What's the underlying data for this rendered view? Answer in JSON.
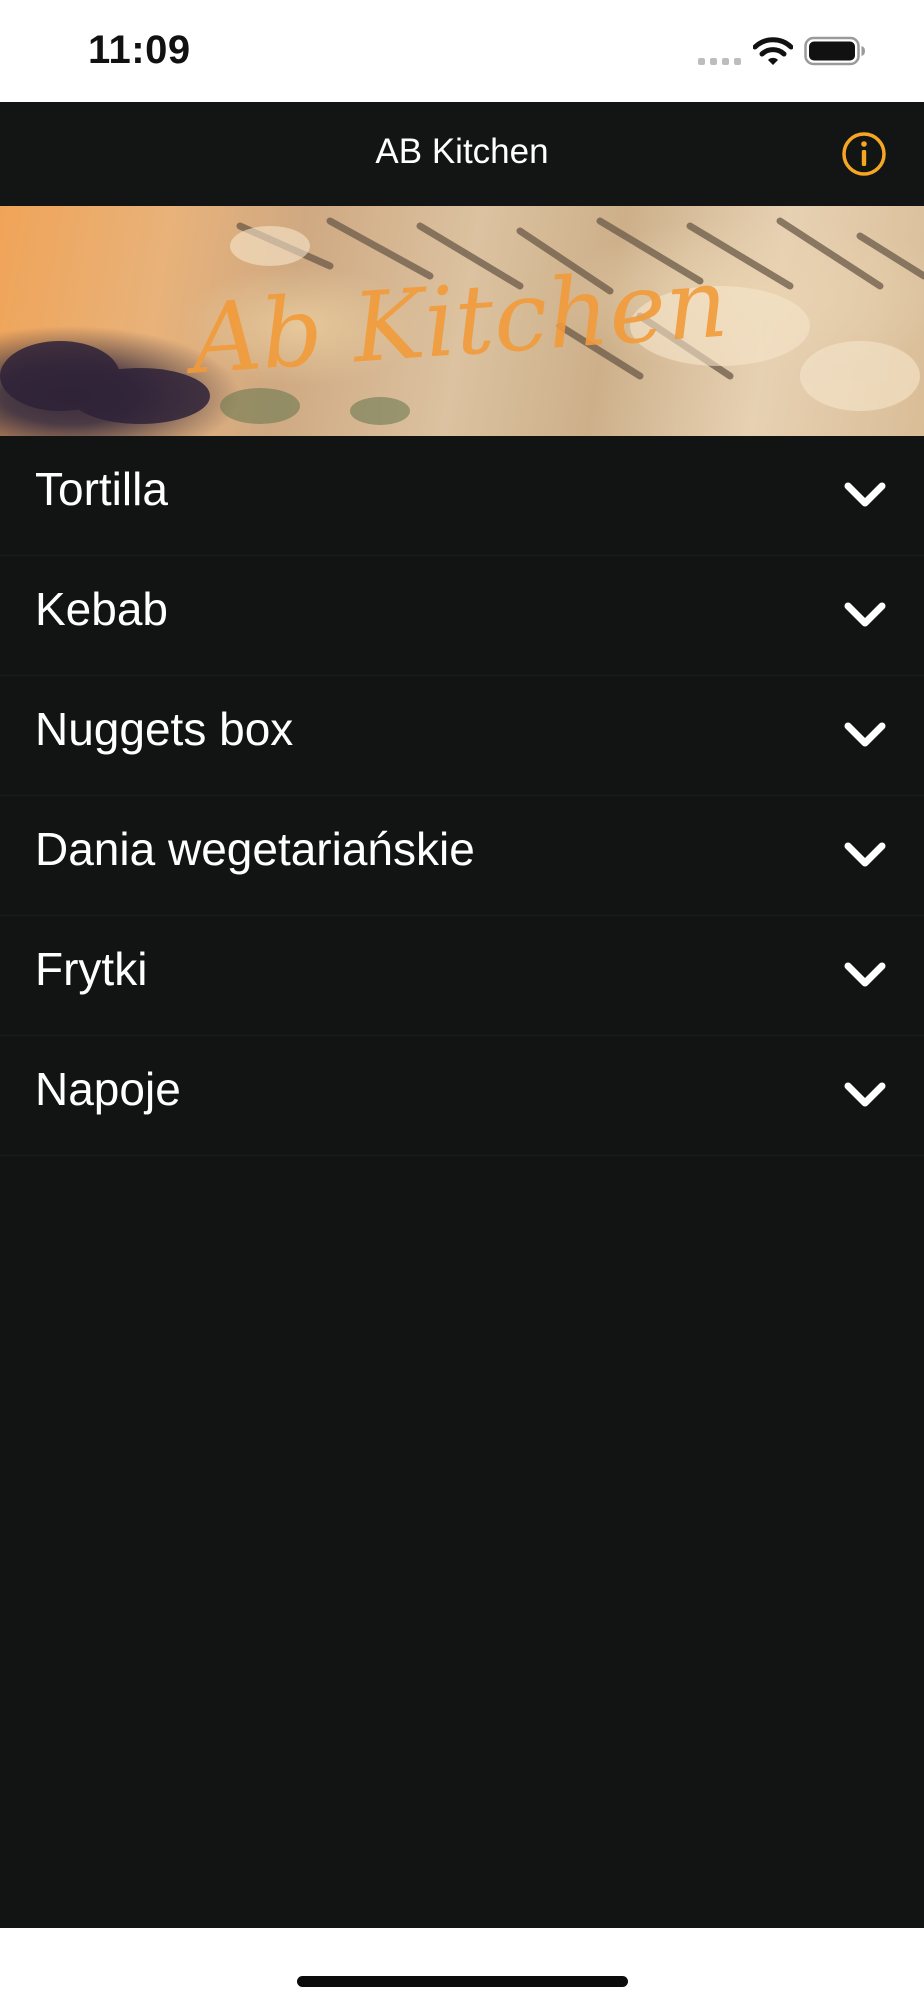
{
  "status_bar": {
    "time": "11:09",
    "icons": [
      "signal-icon",
      "wifi-icon",
      "battery-icon"
    ]
  },
  "nav": {
    "title": "AB Kitchen",
    "info_icon": "info-icon",
    "accent_color": "#f5a623"
  },
  "banner": {
    "logo_text": "Ab Kitchen"
  },
  "menu": {
    "items": [
      {
        "label": "Tortilla",
        "icon": "chevron-down-icon"
      },
      {
        "label": "Kebab",
        "icon": "chevron-down-icon"
      },
      {
        "label": "Nuggets box",
        "icon": "chevron-down-icon"
      },
      {
        "label": "Dania wegetariańskie",
        "icon": "chevron-down-icon"
      },
      {
        "label": "Frytki",
        "icon": "chevron-down-icon"
      },
      {
        "label": "Napoje",
        "icon": "chevron-down-icon"
      }
    ]
  },
  "colors": {
    "background": "#121313",
    "nav_background": "#131414",
    "text": "#ffffff",
    "accent": "#f5a623"
  }
}
